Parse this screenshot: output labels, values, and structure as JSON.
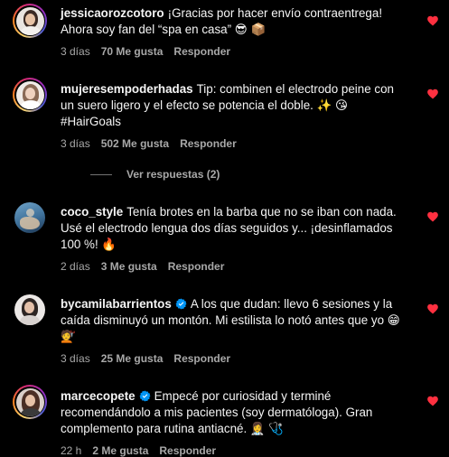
{
  "comments": [
    {
      "username": "jessicaorozcotoro",
      "verified": false,
      "text": "¡Gracias por hacer envío contraentrega! Ahora soy fan del “spa en casa” 😎 📦",
      "time": "3 días",
      "likes": "70 Me gusta",
      "reply": "Responder"
    },
    {
      "username": "mujeresempoderhadas",
      "verified": false,
      "text": "Tip: combinen el electrodo peine con un suero ligero y el efecto se potencia el doble. ✨ 😘 #HairGoals",
      "time": "3 días",
      "likes": "502 Me gusta",
      "reply": "Responder"
    },
    {
      "username": "coco_style",
      "verified": false,
      "text": "Tenía brotes en la barba que no se iban con nada. Usé el electrodo lengua dos días seguidos y... ¡desinflamados 100 %! 🔥",
      "time": "2 días",
      "likes": "3 Me gusta",
      "reply": "Responder"
    },
    {
      "username": "bycamilabarrientos",
      "verified": true,
      "text": "A los que dudan: llevo 6 sesiones y la caída disminuyó un montón. Mi estilista lo notó antes que yo 😁 💇",
      "time": "3 días",
      "likes": "25 Me gusta",
      "reply": "Responder"
    },
    {
      "username": "marcecopete",
      "verified": true,
      "text": "Empecé por curiosidad y terminé recomendándolo a mis pacientes (soy dermatóloga). Gran complemento para rutina antiacné. 👩‍⚕️ 🩺",
      "time": "22 h",
      "likes": "2 Me gusta",
      "reply": "Responder"
    }
  ],
  "view_replies": "Ver respuestas (2)",
  "icons": {
    "like": "heart-icon",
    "verified": "verified-badge-icon"
  },
  "colors": {
    "background": "#000000",
    "text": "#f5f5f5",
    "muted": "#a8a8a8",
    "heart": "#ff3040",
    "verified": "#0095f6"
  }
}
